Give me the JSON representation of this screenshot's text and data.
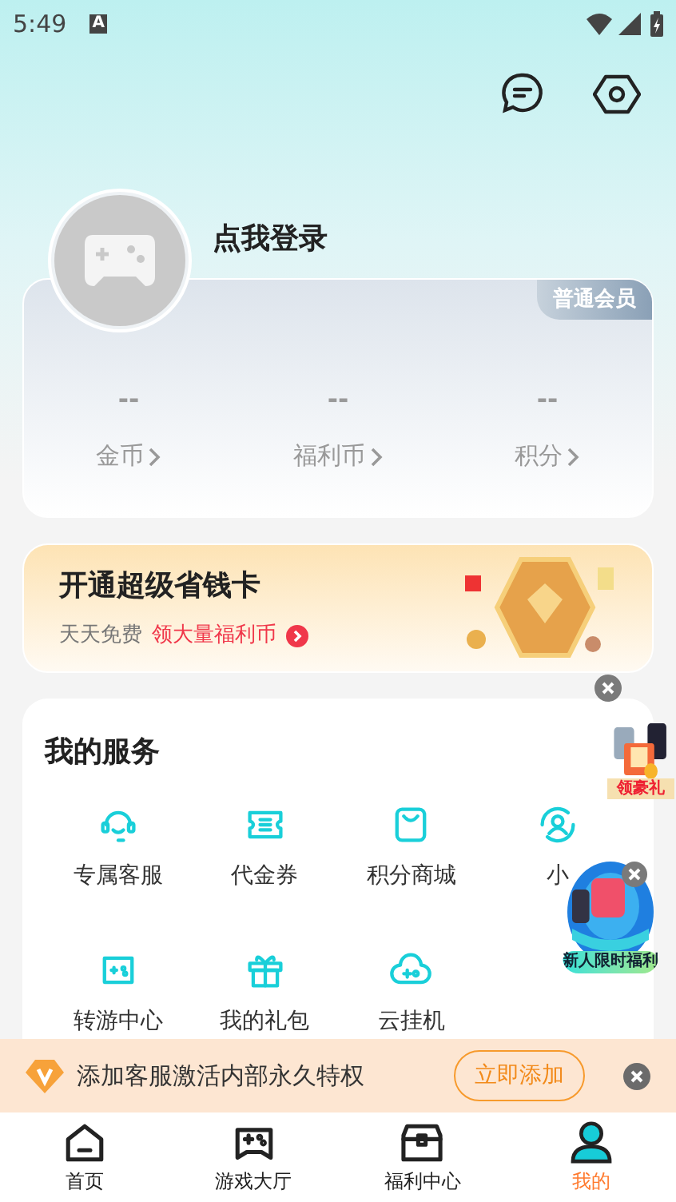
{
  "status_bar": {
    "time": "5:49",
    "notification": "A"
  },
  "profile": {
    "login": "点我登录",
    "member_badge": "普通会员"
  },
  "stats": [
    {
      "value": "--",
      "label": "金币"
    },
    {
      "value": "--",
      "label": "福利币"
    },
    {
      "value": "--",
      "label": "积分"
    }
  ],
  "promo": {
    "title": "开通超级省钱卡",
    "subtitle": "天天免费",
    "highlight": "领大量福利币"
  },
  "services": {
    "title": "我的服务",
    "items": [
      {
        "label": "专属客服"
      },
      {
        "label": "代金券"
      },
      {
        "label": "积分商城"
      },
      {
        "label": "小"
      },
      {
        "label": "转游中心"
      },
      {
        "label": "我的礼包"
      },
      {
        "label": "云挂机"
      }
    ]
  },
  "floating_ads": [
    {
      "label": "领豪礼"
    },
    {
      "label": "新人限时福利"
    }
  ],
  "notice": {
    "text": "添加客服激活内部永久特权",
    "button": "立即添加"
  },
  "tabs": [
    {
      "label": "首页",
      "selected": false
    },
    {
      "label": "游戏大厅",
      "selected": false
    },
    {
      "label": "福利中心",
      "selected": false
    },
    {
      "label": "我的",
      "selected": true
    }
  ]
}
